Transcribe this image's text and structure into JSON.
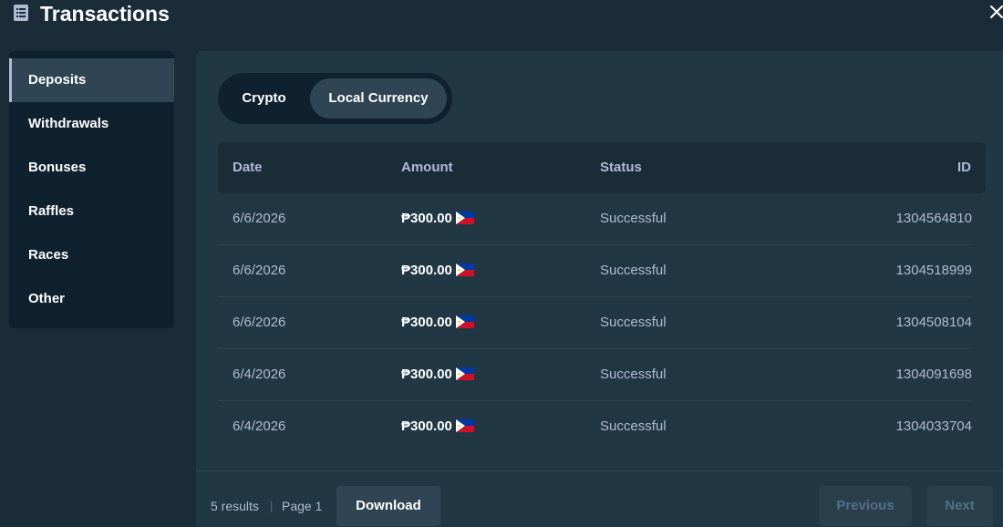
{
  "header": {
    "title": "Transactions",
    "title_icon": "list-document-icon",
    "close_icon": "close-icon"
  },
  "sidebar": {
    "items": [
      {
        "label": "Deposits",
        "active": true
      },
      {
        "label": "Withdrawals",
        "active": false
      },
      {
        "label": "Bonuses",
        "active": false
      },
      {
        "label": "Raffles",
        "active": false
      },
      {
        "label": "Races",
        "active": false
      },
      {
        "label": "Other",
        "active": false
      }
    ]
  },
  "toggle": {
    "crypto_label": "Crypto",
    "local_label": "Local Currency",
    "selected": "Local Currency"
  },
  "table": {
    "columns": {
      "date": "Date",
      "amount": "Amount",
      "status": "Status",
      "id": "ID"
    },
    "rows": [
      {
        "date": "6/6/2026",
        "amount": "₱300.00",
        "flag": "philippines-flag-icon",
        "status": "Successful",
        "id": "1304564810"
      },
      {
        "date": "6/6/2026",
        "amount": "₱300.00",
        "flag": "philippines-flag-icon",
        "status": "Successful",
        "id": "1304518999"
      },
      {
        "date": "6/6/2026",
        "amount": "₱300.00",
        "flag": "philippines-flag-icon",
        "status": "Successful",
        "id": "1304508104"
      },
      {
        "date": "6/4/2026",
        "amount": "₱300.00",
        "flag": "philippines-flag-icon",
        "status": "Successful",
        "id": "1304091698"
      },
      {
        "date": "6/4/2026",
        "amount": "₱300.00",
        "flag": "philippines-flag-icon",
        "status": "Successful",
        "id": "1304033704"
      }
    ]
  },
  "footer": {
    "results": "5 results",
    "separator": "|",
    "page": "Page 1",
    "download_label": "Download",
    "previous_label": "Previous",
    "next_label": "Next"
  },
  "colors": {
    "background": "#1a2c38",
    "panel": "#213743",
    "sidebar": "#0f212e",
    "active": "#2f4553",
    "muted_text": "#b1bad3",
    "disabled_text": "#557086"
  }
}
